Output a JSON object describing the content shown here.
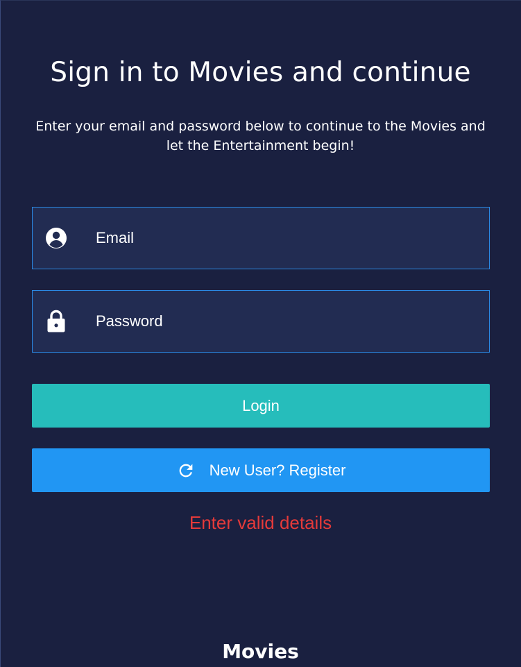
{
  "header": {
    "title": "Sign in to Movies and continue",
    "subtitle": "Enter your email and password below to continue to the Movies and let the Entertainment begin!"
  },
  "form": {
    "email": {
      "placeholder": "Email",
      "value": "",
      "icon": "account-circle-icon"
    },
    "password": {
      "placeholder": "Password",
      "value": "",
      "icon": "lock-icon"
    },
    "login_label": "Login",
    "register_label": "New User? Register",
    "register_icon": "refresh-icon",
    "error_message": "Enter valid details"
  },
  "footer": {
    "brand": "Movies"
  },
  "colors": {
    "background": "#1a2040",
    "field_background": "#222c52",
    "field_border": "#2b8ae6",
    "login_button": "#26bdbb",
    "register_button": "#2196f3",
    "error_text": "#e53a3a",
    "text": "#ffffff"
  }
}
